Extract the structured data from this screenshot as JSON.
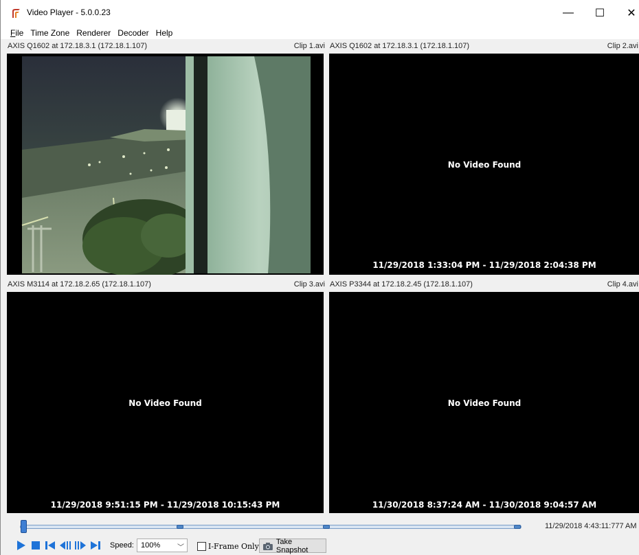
{
  "window": {
    "title": "Video Player - 5.0.0.23",
    "minimize_glyph": "—",
    "maximize_glyph": "☐",
    "close_glyph": "✕"
  },
  "menu": {
    "items": [
      {
        "key": "F",
        "rest": "ile"
      },
      {
        "key": "",
        "rest": "Time Zone"
      },
      {
        "key": "",
        "rest": "Renderer"
      },
      {
        "key": "",
        "rest": "Decoder"
      },
      {
        "key": "",
        "rest": "Help"
      }
    ]
  },
  "panes": [
    {
      "camera": "AXIS Q1602 at 172.18.3.1 (172.18.1.107)",
      "clip": "Clip 1.avi",
      "status": "",
      "time_range": ""
    },
    {
      "camera": "AXIS Q1602 at 172.18.3.1 (172.18.1.107)",
      "clip": "Clip 2.avi",
      "status": "No Video Found",
      "time_range": "11/29/2018 1:33:04 PM - 11/29/2018 2:04:38 PM"
    },
    {
      "camera": "AXIS M3114 at 172.18.2.65 (172.18.1.107)",
      "clip": "Clip 3.avi",
      "status": "No Video Found",
      "time_range": "11/29/2018 9:51:15 PM - 11/29/2018 10:15:43 PM"
    },
    {
      "camera": "AXIS P3344 at 172.18.2.45 (172.18.1.107)",
      "clip": "Clip 4.avi",
      "status": "No Video Found",
      "time_range": "11/30/2018 8:37:24 AM - 11/30/2018 9:04:57 AM"
    }
  ],
  "timeline": {
    "current_time": "11/29/2018 4:43:11:777 AM"
  },
  "controls": {
    "speed_label": "Speed:",
    "speed_value": "100%",
    "iframe_label": "I-Frame Only",
    "iframe_checked": false,
    "snapshot_label": "Take Snapshot",
    "accent": "#1e73d8"
  }
}
